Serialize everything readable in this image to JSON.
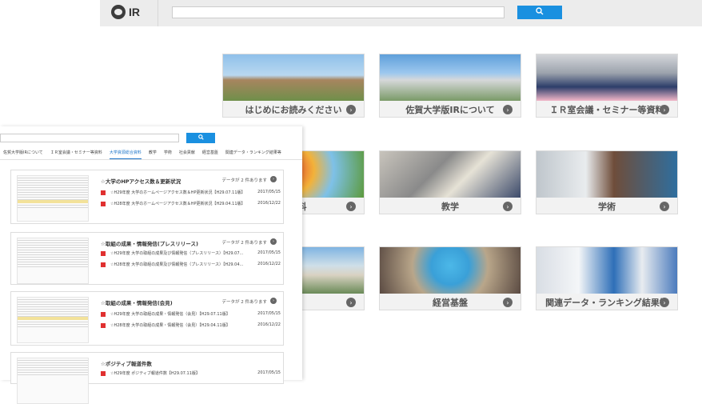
{
  "header": {
    "logo_text": "IR",
    "search_placeholder": "",
    "search_icon": "search-icon"
  },
  "tiles": [
    {
      "label": "はじめにお読みください"
    },
    {
      "label": "佐賀大学版IRについて"
    },
    {
      "label": "ＩＲ室会議・セミナー等資料"
    },
    {
      "label": "会資料"
    },
    {
      "label": "教学"
    },
    {
      "label": "学術"
    },
    {
      "label": "献"
    },
    {
      "label": "経営基盤"
    },
    {
      "label": "関連データ・ランキング結果等"
    }
  ],
  "panel": {
    "nav": [
      "佐賀大学版IRについて",
      "ＩＲ室会議・セミナー等資料",
      "大学資源総合資料",
      "教学",
      "学術",
      "社会貢献",
      "経営基盤",
      "関連データ・ランキング結果等"
    ],
    "cards": [
      {
        "title": "☆大学のHPアクセス数＆更新状況",
        "count": "データが 2 件あります",
        "items": [
          {
            "text": "☆H29年度 大学のホームページアクセス数＆HP更新状況【H29.07.11版】",
            "date": "2017/05/15"
          },
          {
            "text": "☆H28年度 大学のホームページアクセス数＆HP更新状況【H29.04.11版】",
            "date": "2016/12/22"
          }
        ]
      },
      {
        "title": "☆取組の成果・情報発信(プレスリリース)",
        "count": "データが 2 件あります",
        "items": [
          {
            "text": "☆H29年度 大学の取組の成果及び情報発信（プレスリリース）【H29.07...",
            "date": "2017/05/15"
          },
          {
            "text": "☆H28年度 大学の取組の成果及び情報発信（プレスリリース）【H29.04...",
            "date": "2016/12/22"
          }
        ]
      },
      {
        "title": "☆取組の成果・情報発信(会見)",
        "count": "データが 2 件あります",
        "items": [
          {
            "text": "☆H29年度 大学の取組の成果・情報発信（会見）【H29.07.11版】",
            "date": "2017/05/15"
          },
          {
            "text": "☆H28年度 大学の取組の成果・情報発信（会見）【H29.04.11版】",
            "date": "2016/12/22"
          }
        ]
      },
      {
        "title": "☆ポジティブ報道件数",
        "count": "",
        "items": [
          {
            "text": "☆H29年度 ポジティブ報道件数【H29.07.11版】",
            "date": "2017/05/15"
          }
        ]
      }
    ]
  }
}
